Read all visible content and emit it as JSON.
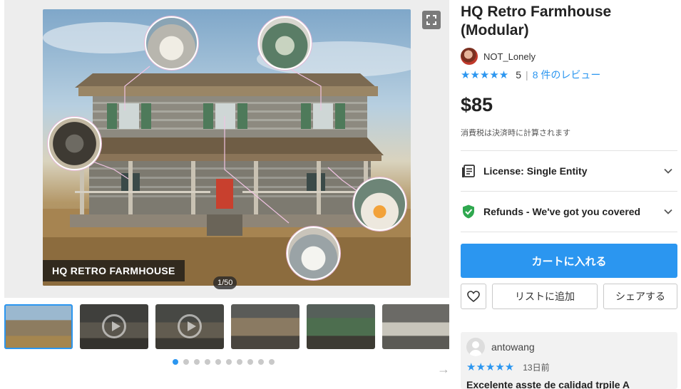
{
  "gallery": {
    "hero_caption": "HQ RETRO FARMHOUSE",
    "counter": "1/50",
    "thumbnail_count": 6,
    "dot_count": 10,
    "active_dot": 0
  },
  "product": {
    "title": "HQ Retro Farmhouse (Modular)",
    "publisher": "NOT_Lonely",
    "stars": "★★★★★",
    "rating": "5",
    "reviews_link": "8 件のレビュー",
    "price": "$85",
    "tax_note": "消費税は決済時に計算されます"
  },
  "accordions": {
    "license": "License: Single Entity",
    "refunds": "Refunds - We've got you covered"
  },
  "actions": {
    "add_to_cart": "カートに入れる",
    "add_to_list": "リストに追加",
    "share": "シェアする"
  },
  "review": {
    "user": "antowang",
    "stars": "★★★★★",
    "date": "13日前",
    "title": "Excelente asste de calidad trpile A"
  },
  "colors": {
    "accent": "#2b96f0",
    "refund_shield": "#2fa84f"
  }
}
